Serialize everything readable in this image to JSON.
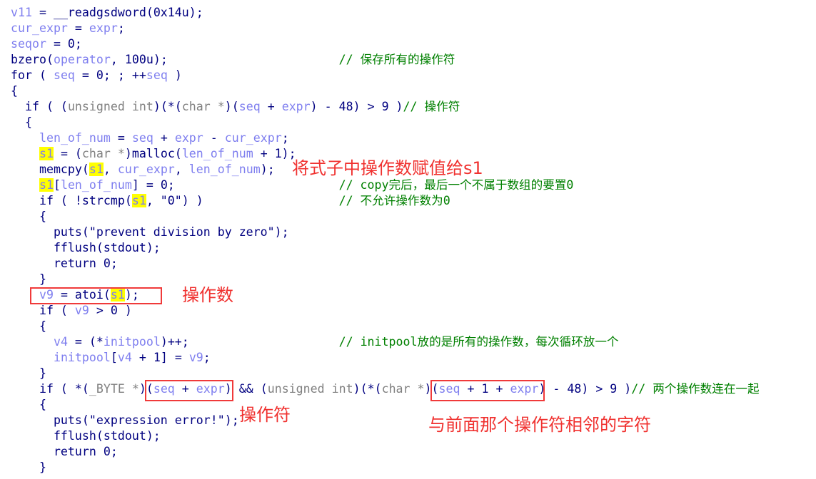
{
  "colors": {
    "keyword": "#000080",
    "variable": "#7f7fef",
    "type": "#808080",
    "comment": "#008000",
    "highlight": "#ffff00",
    "annotation": "#f0312f"
  },
  "code_lines": [
    [
      [
        "v",
        "v11"
      ],
      [
        "k",
        " = __readgsdword(0x14u);"
      ]
    ],
    [
      [
        "v",
        "cur_expr"
      ],
      [
        "k",
        " = "
      ],
      [
        "v",
        "expr"
      ],
      [
        "k",
        ";"
      ]
    ],
    [
      [
        "v",
        "seqor"
      ],
      [
        "k",
        " = 0;"
      ]
    ],
    [
      [
        "k",
        "bzero("
      ],
      [
        "v",
        "operator"
      ],
      [
        "k",
        ", 100u);                        "
      ],
      [
        "c",
        "// 保存所有的操作符"
      ]
    ],
    [
      [
        "k",
        "for ( "
      ],
      [
        "v",
        "seq"
      ],
      [
        "k",
        " = 0; ; ++"
      ],
      [
        "v",
        "seq"
      ],
      [
        "k",
        " )"
      ]
    ],
    [
      [
        "k",
        "{"
      ]
    ],
    [
      [
        "k",
        "  if ( ("
      ],
      [
        "t",
        "unsigned int"
      ],
      [
        "k",
        ")(*("
      ],
      [
        "t",
        "char *"
      ],
      [
        "k",
        ")("
      ],
      [
        "v",
        "seq"
      ],
      [
        "k",
        " + "
      ],
      [
        "v",
        "expr"
      ],
      [
        "k",
        ") - 48) > 9 )"
      ],
      [
        "c",
        "// 操作符"
      ]
    ],
    [
      [
        "k",
        "  {"
      ]
    ],
    [
      [
        "k",
        "    "
      ],
      [
        "v",
        "len_of_num"
      ],
      [
        "k",
        " = "
      ],
      [
        "v",
        "seq"
      ],
      [
        "k",
        " + "
      ],
      [
        "v",
        "expr"
      ],
      [
        "k",
        " - "
      ],
      [
        "v",
        "cur_expr"
      ],
      [
        "k",
        ";"
      ]
    ],
    [
      [
        "k",
        "    "
      ],
      [
        "h",
        "s1"
      ],
      [
        "k",
        " = ("
      ],
      [
        "t",
        "char *"
      ],
      [
        "k",
        ")malloc("
      ],
      [
        "v",
        "len_of_num"
      ],
      [
        "k",
        " + 1);"
      ]
    ],
    [
      [
        "k",
        "    memcpy("
      ],
      [
        "h",
        "s1"
      ],
      [
        "k",
        ", "
      ],
      [
        "v",
        "cur_expr"
      ],
      [
        "k",
        ", "
      ],
      [
        "v",
        "len_of_num"
      ],
      [
        "k",
        ");"
      ]
    ],
    [
      [
        "k",
        "    "
      ],
      [
        "h",
        "s1"
      ],
      [
        "k",
        "["
      ],
      [
        "v",
        "len_of_num"
      ],
      [
        "k",
        "] = 0;                       "
      ],
      [
        "c",
        "// copy完后，最后一个不属于数组的要置0"
      ]
    ],
    [
      [
        "k",
        "    if ( !strcmp("
      ],
      [
        "h",
        "s1"
      ],
      [
        "k",
        ", \"0\") )                   "
      ],
      [
        "c",
        "// 不允许操作数为0"
      ]
    ],
    [
      [
        "k",
        "    {"
      ]
    ],
    [
      [
        "k",
        "      puts(\"prevent division by zero\");"
      ]
    ],
    [
      [
        "k",
        "      fflush(stdout);"
      ]
    ],
    [
      [
        "k",
        "      return 0;"
      ]
    ],
    [
      [
        "k",
        "    }"
      ]
    ],
    [
      [
        "k",
        "    "
      ],
      [
        "v",
        "v9"
      ],
      [
        "k",
        " = atoi("
      ],
      [
        "h",
        "s1"
      ],
      [
        "k",
        ");"
      ]
    ],
    [
      [
        "k",
        "    if ( "
      ],
      [
        "v",
        "v9"
      ],
      [
        "k",
        " > 0 )"
      ]
    ],
    [
      [
        "k",
        "    {"
      ]
    ],
    [
      [
        "k",
        "      "
      ],
      [
        "v",
        "v4"
      ],
      [
        "k",
        " = (*"
      ],
      [
        "v",
        "initpool"
      ],
      [
        "k",
        ")++;                     "
      ],
      [
        "c",
        "// initpool放的是所有的操作数，每次循环放一个"
      ]
    ],
    [
      [
        "k",
        "      "
      ],
      [
        "v",
        "initpool"
      ],
      [
        "k",
        "["
      ],
      [
        "v",
        "v4"
      ],
      [
        "k",
        " + 1] = "
      ],
      [
        "v",
        "v9"
      ],
      [
        "k",
        ";"
      ]
    ],
    [
      [
        "k",
        "    }"
      ]
    ],
    [
      [
        "k",
        "    if ( *("
      ],
      [
        "t",
        "_BYTE *"
      ],
      [
        "k",
        ")("
      ],
      [
        "v",
        "seq"
      ],
      [
        "k",
        " + "
      ],
      [
        "v",
        "expr"
      ],
      [
        "k",
        ") && ("
      ],
      [
        "t",
        "unsigned int"
      ],
      [
        "k",
        ")(*("
      ],
      [
        "t",
        "char *"
      ],
      [
        "k",
        ")("
      ],
      [
        "v",
        "seq"
      ],
      [
        "k",
        " + 1 + "
      ],
      [
        "v",
        "expr"
      ],
      [
        "k",
        ") - 48) > 9 )"
      ],
      [
        "c",
        "// 两个操作数连在一起"
      ]
    ],
    [
      [
        "k",
        "    {"
      ]
    ],
    [
      [
        "k",
        "      puts(\"expression error!\");"
      ]
    ],
    [
      [
        "k",
        "      fflush(stdout);"
      ]
    ],
    [
      [
        "k",
        "      return 0;"
      ]
    ],
    [
      [
        "k",
        "    }"
      ]
    ]
  ],
  "annotations": {
    "assign_s1": "将式子中操作数赋值给s1",
    "operand": "操作数",
    "operator": "操作符",
    "adjacent_char": "与前面那个操作符相邻的字符"
  }
}
